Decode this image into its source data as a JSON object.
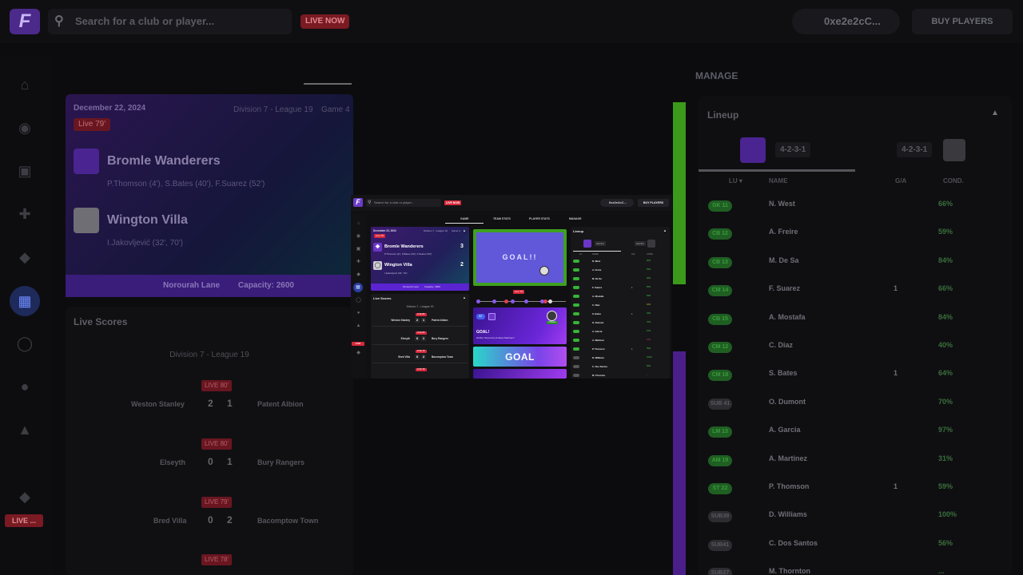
{
  "background": {
    "logo": "F",
    "search_placeholder": "Search for a club or player...",
    "live_now": "LIVE NOW",
    "wallet": "0xe2e2cC...",
    "buy_players": "BUY PLAYERS",
    "manage_tab": "MANAGE",
    "side_live": "LIVE ...",
    "match": {
      "date": "December 22, 2024",
      "division": "Division 7 - League 19",
      "game": "Game 4",
      "live": "Live 79'",
      "home": "Bromle Wanderers",
      "home_scorers": "P.Thomson (4'), S.Bates (40'), F.Suarez (52')",
      "away": "Wington Villa",
      "away_scorers": "I.Jakovljević (32', 70')",
      "stadium": "Norourah Lane",
      "capacity": "Capacity: 2600"
    },
    "live_scores": {
      "title": "Live Scores",
      "division": "Division 7 - League 19",
      "matches": [
        {
          "badge": "LIVE 80'",
          "home": "Weston Stanley",
          "hs": "2",
          "as": "1",
          "away": "Patent Albion"
        },
        {
          "badge": "LIVE 80'",
          "home": "Elseyth",
          "hs": "0",
          "as": "1",
          "away": "Bury Rangers"
        },
        {
          "badge": "LIVE 79'",
          "home": "Bred Villa",
          "hs": "0",
          "as": "2",
          "away": "Bacomptow Town"
        },
        {
          "badge": "LIVE 78'"
        }
      ]
    },
    "lineup": {
      "title": "Lineup",
      "formation_home": "4-2-3-1",
      "formation_away": "4-2-3-1",
      "col_lu": "LU ▾",
      "col_name": "NAME",
      "col_ga": "G/A",
      "col_cond": "COND.",
      "rows": [
        {
          "pos": "GK 11",
          "name": "N. West",
          "cond": "66%"
        },
        {
          "pos": "CB 12",
          "name": "A. Freire",
          "cond": "59%"
        },
        {
          "pos": "CB 13",
          "name": "M. De Sa",
          "cond": "84%"
        },
        {
          "pos": "CM 14",
          "name": "F. Suarez",
          "ga": "1",
          "cond": "66%"
        },
        {
          "pos": "CB 15",
          "name": "A. Mostafa",
          "cond": "84%"
        },
        {
          "pos": "CM 12",
          "name": "C. Diaz",
          "cond": "40%"
        },
        {
          "pos": "CM 18",
          "name": "S. Bates",
          "ga": "1",
          "cond": "64%"
        },
        {
          "pos": "SUB 41",
          "name": "O. Dumont",
          "cond": "70%"
        },
        {
          "pos": "LM 13",
          "name": "A. Garcia",
          "cond": "97%"
        },
        {
          "pos": "AM 19",
          "name": "A. Martinez",
          "cond": "31%"
        },
        {
          "pos": "ST 22",
          "name": "P. Thomson",
          "ga": "1",
          "cond": "59%"
        },
        {
          "pos": "SUB39",
          "name": "D. Williams",
          "cond": "100%"
        },
        {
          "pos": "SUB41",
          "name": "C. Dos Santos",
          "cond": "56%"
        },
        {
          "pos": "SUB27",
          "name": "M. Thornton",
          "cond": "..."
        }
      ]
    }
  },
  "screen": {
    "logo": "F",
    "search_placeholder": "Search for a club or player...",
    "live_now": "LIVE NOW",
    "wallet": "0xe2e2cC...",
    "buy_players": "BUY PLAYERS",
    "tabs": [
      "GAME",
      "TEAM STATS",
      "PLAYER STATS",
      "MANAGE"
    ],
    "side_live": "LIVE",
    "match": {
      "date": "December 22, 2024",
      "division": "Division 7 - League 19",
      "game": "Game 4",
      "live": "Live 79'",
      "home": "Bromle Wanderers",
      "home_score": "3",
      "home_scorers": "P.Thomson (4'), S.Bates (40'), F.Suarez (52')",
      "away": "Wington Villa",
      "away_score": "2",
      "away_scorers": "I.Jakovljević (32', 70')",
      "stadium": "Norourah Lane",
      "capacity": "Capacity: 2600"
    },
    "live_scores": {
      "title": "Live Scores",
      "division": "Division 7 - League 19",
      "matches": [
        {
          "badge": "LIVE 80'",
          "home": "Weston Stanley",
          "hs": "2",
          "as": "1",
          "away": "Patent Albion"
        },
        {
          "badge": "LIVE 80'",
          "home": "Elseyth",
          "hs": "0",
          "as": "1",
          "away": "Bury Rangers"
        },
        {
          "badge": "LIVE 79'",
          "home": "Bred Villa",
          "hs": "0",
          "as": "2",
          "away": "Bacomptow Town"
        },
        {
          "badge": "LIVE 78'"
        }
      ]
    },
    "event": {
      "goal_box_text": "GOAL!!",
      "live_badge": "Live 79'",
      "minute": "52'",
      "player_tag": "F.Suarez",
      "event_title": "GOAL!",
      "event_sub": "GOAL! Scored by Andrew Martinez!",
      "banner": "GOAL"
    },
    "lineup": {
      "title": "Lineup",
      "formation_home": "4-2-3-1",
      "formation_away": "4-2-3-1",
      "col_lu": "LU",
      "col_name": "NAME",
      "col_ga": "G/A",
      "col_cond": "COND.",
      "rows": [
        {
          "name": "N. West",
          "cond": "66%"
        },
        {
          "name": "A. Freire",
          "cond": "59%"
        },
        {
          "name": "M. De Sa",
          "cond": "84%"
        },
        {
          "name": "F. Suarez",
          "ga": "1",
          "cond": "66%"
        },
        {
          "name": "A. Mostafa",
          "cond": "84%"
        },
        {
          "name": "C. Diaz",
          "cond": "40%"
        },
        {
          "name": "S. Bates",
          "ga": "1",
          "cond": "64%"
        },
        {
          "name": "O. Dumont",
          "cond": "70%"
        },
        {
          "name": "A. Garcia",
          "cond": "97%"
        },
        {
          "name": "A. Martinez",
          "cond": "31%"
        },
        {
          "name": "P. Thomson",
          "ga": "1",
          "cond": "59%"
        },
        {
          "name": "D. Williams",
          "cond": "100%"
        },
        {
          "name": "C. Dos Santos",
          "cond": "56%"
        },
        {
          "name": "M. Thornton",
          "cond": "..."
        }
      ]
    }
  },
  "colors": {
    "accent": "#6b36c8",
    "live": "#d8283a",
    "good": "#36b536"
  }
}
